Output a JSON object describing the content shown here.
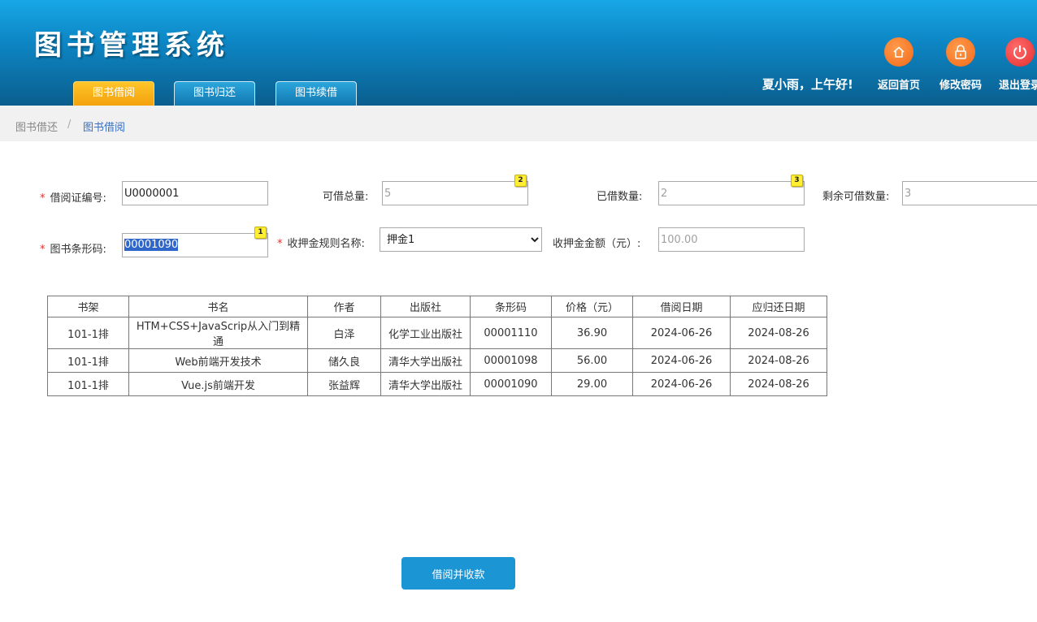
{
  "header": {
    "app_title": "图书管理系统",
    "tabs": [
      {
        "label": "图书借阅",
        "active": true
      },
      {
        "label": "图书归还",
        "active": false
      },
      {
        "label": "图书续借",
        "active": false
      }
    ],
    "greeting": "夏小雨，上午好!",
    "actions": [
      {
        "label": "返回首页",
        "icon": "home-icon"
      },
      {
        "label": "修改密码",
        "icon": "lock-icon"
      },
      {
        "label": "退出登录",
        "icon": "power-icon"
      }
    ]
  },
  "breadcrumb": {
    "parent": "图书借还",
    "separator": "/",
    "current": "图书借阅"
  },
  "form": {
    "card_no": {
      "label": "借阅证编号:",
      "value": "U0000001"
    },
    "total": {
      "label": "可借总量:",
      "value": "5",
      "badge": "2"
    },
    "borrowed": {
      "label": "已借数量:",
      "value": "2",
      "badge": "3"
    },
    "remaining": {
      "label": "剩余可借数量:",
      "value": "3"
    },
    "barcode": {
      "label": "图书条形码:",
      "value": "00001090",
      "badge": "1"
    },
    "deposit_rule": {
      "label": "收押金规则名称:",
      "selected": "押金1"
    },
    "deposit_amount": {
      "label": "收押金金额（元）:",
      "value": "100.00"
    }
  },
  "table": {
    "headers": [
      "书架",
      "书名",
      "作者",
      "出版社",
      "条形码",
      "价格（元）",
      "借阅日期",
      "应归还日期"
    ],
    "rows": [
      [
        "101-1排",
        "HTM+CSS+JavaScrip从入门到精通",
        "白泽",
        "化学工业出版社",
        "00001110",
        "36.90",
        "2024-06-26",
        "2024-08-26"
      ],
      [
        "101-1排",
        "Web前端开发技术",
        "储久良",
        "清华大学出版社",
        "00001098",
        "56.00",
        "2024-06-26",
        "2024-08-26"
      ],
      [
        "101-1排",
        "Vue.js前端开发",
        "张益辉",
        "清华大学出版社",
        "00001090",
        "29.00",
        "2024-06-26",
        "2024-08-26"
      ]
    ]
  },
  "submit_label": "借阅并收款",
  "colors": {
    "header_top": "#18a7e6",
    "header_bottom": "#0a5e8e",
    "active_tab": "#f3a10b",
    "action_orange": "#f26a1b",
    "logout_red": "#e52d2d",
    "submit": "#1b95d4"
  }
}
